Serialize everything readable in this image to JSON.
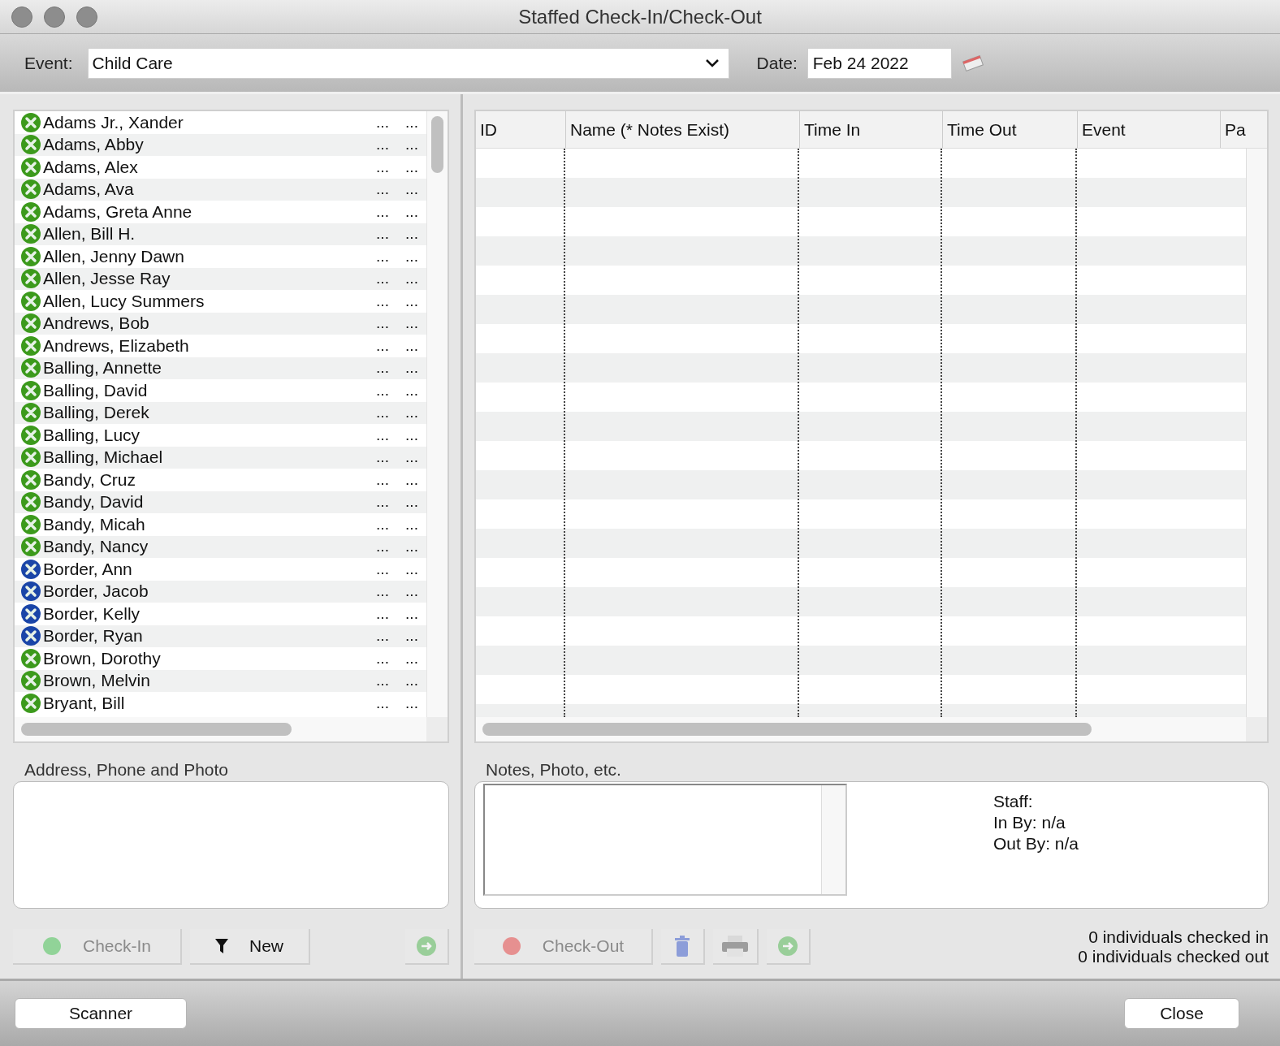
{
  "window": {
    "title": "Staffed Check-In/Check-Out"
  },
  "toolbar": {
    "event_label": "Event:",
    "event_value": "Child Care",
    "date_label": "Date:",
    "date_value": "Feb 24 2022"
  },
  "people": [
    {
      "name": "Adams Jr., Xander",
      "color": "#3c9a1c",
      "column_2": "...",
      "column_3": "..."
    },
    {
      "name": "Adams, Abby",
      "color": "#3c9a1c",
      "column_2": "...",
      "column_3": "..."
    },
    {
      "name": "Adams, Alex",
      "color": "#3c9a1c",
      "column_2": "...",
      "column_3": "..."
    },
    {
      "name": "Adams, Ava",
      "color": "#3c9a1c",
      "column_2": "...",
      "column_3": "..."
    },
    {
      "name": "Adams, Greta Anne",
      "color": "#3c9a1c",
      "column_2": "...",
      "column_3": "..."
    },
    {
      "name": "Allen, Bill H.",
      "color": "#3c9a1c",
      "column_2": "...",
      "column_3": "..."
    },
    {
      "name": "Allen, Jenny Dawn",
      "color": "#3c9a1c",
      "column_2": "...",
      "column_3": "..."
    },
    {
      "name": "Allen, Jesse Ray",
      "color": "#3c9a1c",
      "column_2": "...",
      "column_3": "..."
    },
    {
      "name": "Allen, Lucy Summers",
      "color": "#3c9a1c",
      "column_2": "...",
      "column_3": "..."
    },
    {
      "name": "Andrews, Bob",
      "color": "#3c9a1c",
      "column_2": "...",
      "column_3": "..."
    },
    {
      "name": "Andrews, Elizabeth",
      "color": "#3c9a1c",
      "column_2": "...",
      "column_3": "..."
    },
    {
      "name": "Balling, Annette",
      "color": "#3c9a1c",
      "column_2": "...",
      "column_3": "..."
    },
    {
      "name": "Balling, David",
      "color": "#3c9a1c",
      "column_2": "...",
      "column_3": "..."
    },
    {
      "name": "Balling, Derek",
      "color": "#3c9a1c",
      "column_2": "...",
      "column_3": "..."
    },
    {
      "name": "Balling, Lucy",
      "color": "#3c9a1c",
      "column_2": "...",
      "column_3": "..."
    },
    {
      "name": "Balling, Michael",
      "color": "#3c9a1c",
      "column_2": "...",
      "column_3": "..."
    },
    {
      "name": "Bandy, Cruz",
      "color": "#3c9a1c",
      "column_2": "...",
      "column_3": "..."
    },
    {
      "name": "Bandy, David",
      "color": "#3c9a1c",
      "column_2": "...",
      "column_3": "..."
    },
    {
      "name": "Bandy, Micah",
      "color": "#3c9a1c",
      "column_2": "...",
      "column_3": "..."
    },
    {
      "name": "Bandy, Nancy",
      "color": "#3c9a1c",
      "column_2": "...",
      "column_3": "..."
    },
    {
      "name": "Border, Ann",
      "color": "#1a45a8",
      "column_2": "...",
      "column_3": "..."
    },
    {
      "name": "Border, Jacob",
      "color": "#1a45a8",
      "column_2": "...",
      "column_3": "..."
    },
    {
      "name": "Border, Kelly",
      "color": "#1a45a8",
      "column_2": "...",
      "column_3": "..."
    },
    {
      "name": "Border, Ryan",
      "color": "#1a45a8",
      "column_2": "...",
      "column_3": "..."
    },
    {
      "name": "Brown, Dorothy",
      "color": "#3c9a1c",
      "column_2": "...",
      "column_3": "..."
    },
    {
      "name": "Brown, Melvin",
      "color": "#3c9a1c",
      "column_2": "...",
      "column_3": "..."
    },
    {
      "name": "Bryant, Bill",
      "color": "#3c9a1c",
      "column_2": "...",
      "column_3": "..."
    }
  ],
  "table": {
    "columns": [
      "ID",
      "Name (* Notes Exist)",
      "Time In",
      "Time Out",
      "Event",
      "Pa"
    ]
  },
  "address_panel": {
    "title": "Address, Phone and Photo"
  },
  "notes_panel": {
    "title": "Notes, Photo, etc.",
    "staff_lines": [
      "Staff:",
      "In By: n/a",
      "Out By: n/a"
    ]
  },
  "left_buttons": [
    {
      "kind": "check-in",
      "label": "Check-In",
      "disabled": true
    },
    {
      "kind": "filter",
      "label": "New",
      "disabled": false
    },
    {
      "kind": "forward",
      "disabled": true
    }
  ],
  "right_buttons": [
    {
      "kind": "check-out",
      "label": "Check-Out",
      "disabled": true
    },
    {
      "kind": "trash",
      "disabled": true
    },
    {
      "kind": "print",
      "disabled": true
    },
    {
      "kind": "forward",
      "disabled": true
    }
  ],
  "status": [
    "0 individuals checked in",
    "0 individuals checked out"
  ],
  "footer_buttons": [
    "Scanner",
    "Close"
  ]
}
